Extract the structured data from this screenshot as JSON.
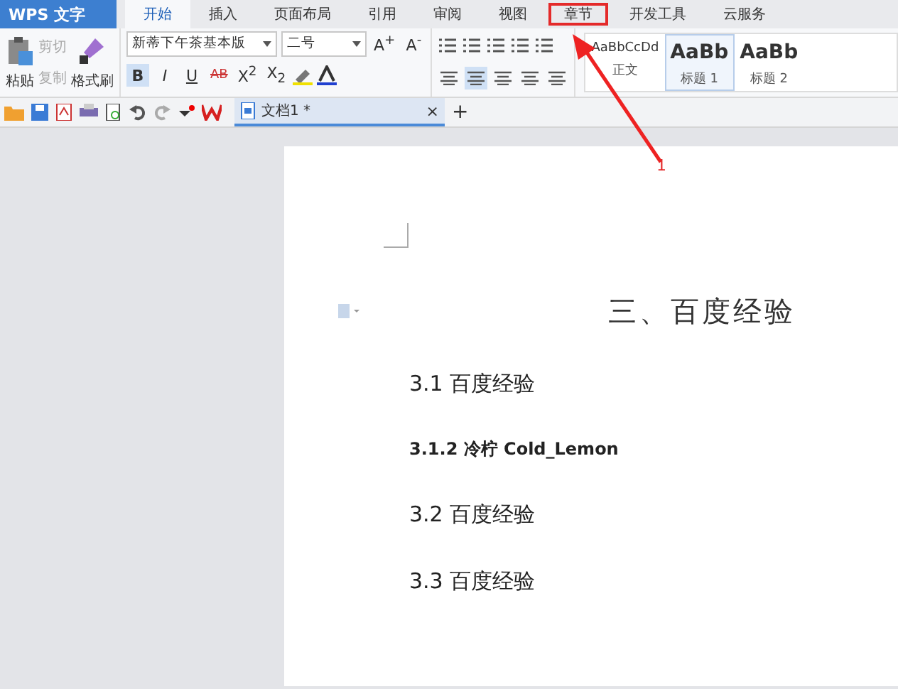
{
  "app_menu": {
    "label": "WPS 文字"
  },
  "tabs": [
    {
      "label": "开始",
      "selected": true,
      "highlighted": false
    },
    {
      "label": "插入",
      "selected": false,
      "highlighted": false
    },
    {
      "label": "页面布局",
      "selected": false,
      "highlighted": false
    },
    {
      "label": "引用",
      "selected": false,
      "highlighted": false
    },
    {
      "label": "审阅",
      "selected": false,
      "highlighted": false
    },
    {
      "label": "视图",
      "selected": false,
      "highlighted": false
    },
    {
      "label": "章节",
      "selected": false,
      "highlighted": true
    },
    {
      "label": "开发工具",
      "selected": false,
      "highlighted": false
    },
    {
      "label": "云服务",
      "selected": false,
      "highlighted": false
    }
  ],
  "clipboard": {
    "paste": "粘贴",
    "format_painter": "格式刷",
    "items": [
      {
        "label": "剪切",
        "disabled": true
      },
      {
        "label": "复制",
        "disabled": true
      }
    ]
  },
  "font": {
    "name": "新蒂下午茶基本版",
    "size": "二号",
    "size_buttons": [
      "A$^{+}$",
      "A$^{-}$"
    ],
    "buttons": [
      {
        "label": "B",
        "selected": true
      },
      {
        "label": "I",
        "selected": false
      },
      {
        "label": "U",
        "selected": false
      },
      {
        "label": "AB",
        "selected": false
      },
      {
        "label": "X$^{2}$",
        "selected": false
      },
      {
        "label": "X$_{2}$",
        "selected": false
      }
    ]
  },
  "paragraph": {
    "align": [
      {
        "selected": false
      },
      {
        "selected": true
      },
      {
        "selected": false
      },
      {
        "selected": false
      },
      {
        "selected": false
      }
    ]
  },
  "styles": [
    {
      "sample": "AaBbCcDd",
      "label": "正文",
      "selected": false
    },
    {
      "sample": "AaBb",
      "label": "标题 1",
      "selected": true
    },
    {
      "sample": "AaBb",
      "label": "标题 2",
      "selected": false
    }
  ],
  "doc_tab": {
    "title": "文档1 *",
    "close": "×",
    "new": "+"
  },
  "document": {
    "title": "三、百度经验",
    "paragraphs": [
      {
        "text": "3.1 百度经验",
        "kind": "heading2"
      },
      {
        "text": "3.1.2 冷柠 Cold_Lemon",
        "kind": "heading3"
      },
      {
        "text": "3.2 百度经验",
        "kind": "heading2"
      },
      {
        "text": "3.3 百度经验",
        "kind": "heading2"
      }
    ]
  },
  "annotation": {
    "number": "1"
  }
}
